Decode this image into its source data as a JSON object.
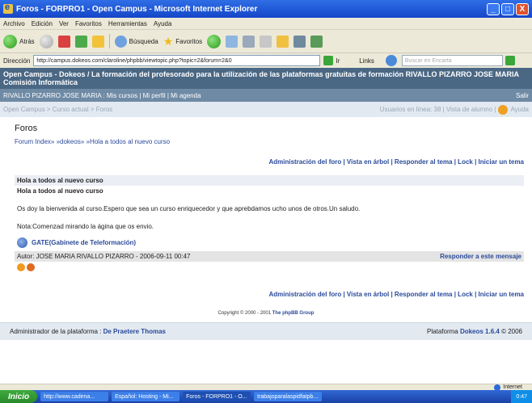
{
  "window": {
    "title": "Foros - FORPRO1 - Open Campus - Microsoft Internet Explorer",
    "min": "_",
    "max": "□",
    "close": "X"
  },
  "menu": [
    "Archivo",
    "Edición",
    "Ver",
    "Favoritos",
    "Herramientas",
    "Ayuda"
  ],
  "toolbar": {
    "back": "Atrás",
    "search": "Búsqueda",
    "favorites": "Favoritos"
  },
  "address": {
    "label": "Dirección",
    "url": "http://campus.dokeos.com/claroline/phpbb/viewtopic.php?topic=2&forum=2&0",
    "go": "Ir",
    "links": "Links",
    "search_placeholder": "Buscar en Encarta"
  },
  "page": {
    "header_title": "Open Campus - Dokeos  /  La formación del profesorado para la utilización de las plataformas gratuitas de formación RIVALLO PIZARRO JOSE MARIA Comisión Informática",
    "user_bar_left": "RIVALLO PIZARRO JOSE MARIA : Mis cursos | Mi perfil | Mi agenda",
    "user_bar_right": "Salir",
    "nav_left": "Open Campus > Curso actual > Foros",
    "nav_right": "Usuarios en línea: 38 | Vista de alumno  |",
    "help": "Ayuda",
    "section_title": "Foros",
    "breadcrumb": "Forum Index» »dokeos» »Hola a todos al nuevo curso",
    "actions": "Administración del foro | Vista en árbol | Responder al tema | Lock | Iniciar un tema",
    "post_subject": "Hola a todos al nuevo curso",
    "post_subject2": "Hola a todos al nuevo curso",
    "post_body": "Os doy la bienvenida al curso.Espero que sea un curso enriquecedor y que aprebdamos ucho unos de otros.Un saludo.",
    "post_note": "Nota:Comenzad mirando la ágina que os envio.",
    "gate_link": "GATE(Gabinete de Teleformación)",
    "author": "Autor: JOSE MARIA RIVALLO PIZARRO - 2006-09-11 00:47",
    "reply": "Responder a este mensaje",
    "actions_bottom": "Administración del foro | Vista en árbol | Responder al tema | Lock | Iniciar un tema",
    "copyright": "Copyright © 2000 - 2001",
    "copyright_link": "The phpBB Group",
    "footer_left_label": "Administrador de la plataforma : ",
    "footer_admin": "De Praetere Thomas",
    "footer_right_label": "Plataforma ",
    "footer_platform": "Dokeos 1.6.4",
    "footer_year": " © 2006"
  },
  "status": {
    "zone": "Internet"
  },
  "taskbar": {
    "start": "Inicio",
    "tasks": [
      "http://www.cadena...",
      "Español: Hosting - Mi...",
      "Foros - FORPRO1 - O...",
      "trabajoparalaspidfatpb..."
    ],
    "clock": "0:47"
  },
  "colors": {
    "header": "#4a6784",
    "link": "#2b4a9a"
  }
}
